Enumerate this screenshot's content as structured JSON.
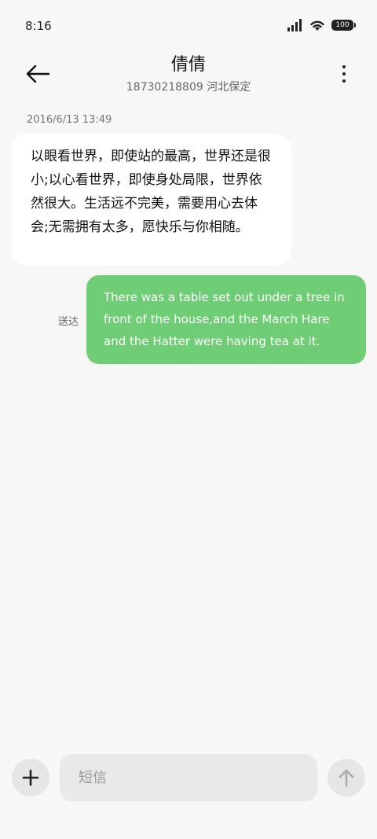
{
  "status_bar": {
    "time": "8:16",
    "battery": "100"
  },
  "header": {
    "contact_name": "倩倩",
    "contact_detail": "18730218809 河北保定"
  },
  "conversation": {
    "timestamp": "2016/6/13 13:49",
    "received_message": "以眼看世界，即使站的最高，世界还是很小;以心看世界，即使身处局限，世界依然很大。生活远不完美，需要用心去体会;无需拥有太多，愿快乐与你相随。",
    "sent_message": "There was a table set out under a tree in front of the house,and the March Hare and the Hatter were having tea at it.",
    "sent_status": "送达"
  },
  "composer": {
    "placeholder": "短信"
  },
  "colors": {
    "sent_bubble": "#6fce75",
    "received_bubble": "#ffffff",
    "background": "#f7f7f7"
  }
}
